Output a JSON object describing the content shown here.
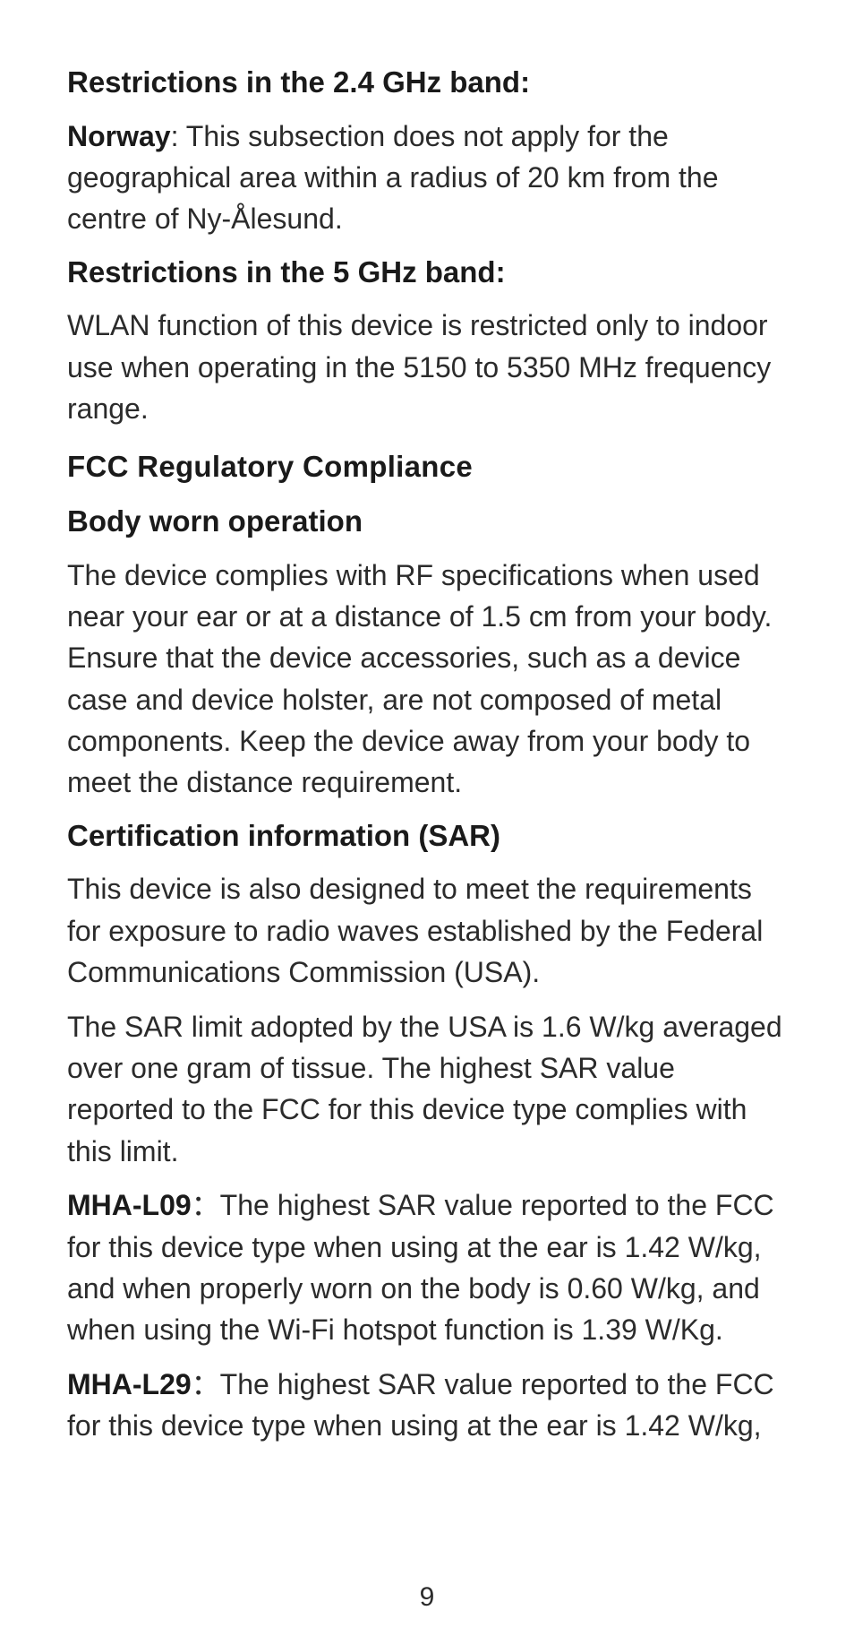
{
  "s1": {
    "h": "Restrictions in the 2.4 GHz band:",
    "p1_b": "Norway",
    "p1": ": This subsection does not apply for the geographical area within a radius of 20 km from the centre of Ny-Ålesund."
  },
  "s2": {
    "h": "Restrictions in the 5 GHz band:",
    "p1": "WLAN function of this device is restricted only to indoor use when operating in the 5150 to 5350 MHz frequency range."
  },
  "s3": {
    "h": "FCC Regulatory Compliance"
  },
  "s4": {
    "h": "Body worn operation",
    "p1": "The device complies with RF specifications when used near your ear or at a distance of 1.5 cm from your body. Ensure that the device accessories, such as a device case and device holster, are not composed of metal components. Keep the device away from your body to meet the distance requirement."
  },
  "s5": {
    "h": "Certification information (SAR)",
    "p1": "This device is also designed to meet the requirements for exposure to radio waves established by the Federal Communications Commission (USA).",
    "p2": "The SAR limit adopted by the USA is 1.6 W/kg averaged over one gram of tissue. The highest SAR value reported to the FCC for this device type complies with this limit.",
    "p3_b": "MHA-L09",
    "p3": "：The highest SAR value reported to the FCC for this device type when using at the ear is 1.42 W/kg, and when properly worn on the body is 0.60 W/kg, and when using the Wi-Fi hotspot function is 1.39 W/Kg.",
    "p4_b": "MHA-L29",
    "p4": "：The highest SAR value reported to the FCC for this device type when using at the ear is 1.42 W/kg,"
  },
  "page_number": "9"
}
